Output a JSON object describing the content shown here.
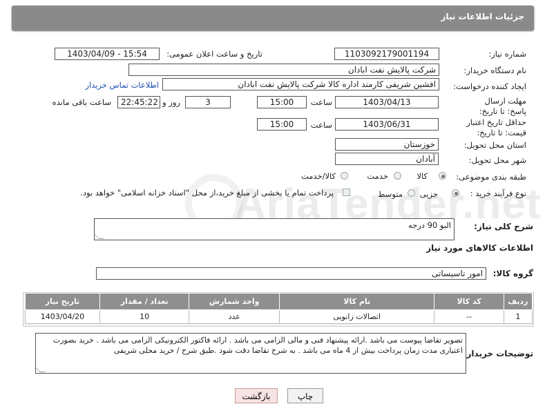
{
  "header": {
    "title": "جزئیات اطلاعات نیاز"
  },
  "watermark": {
    "text": "AriaTender.net"
  },
  "fields": {
    "need_number": {
      "label": "شماره نیاز:",
      "value": "1103092179001194"
    },
    "announce": {
      "label": "تاریخ و ساعت اعلان عمومی:",
      "value": "1403/04/09 - 15:54"
    },
    "buyer_org": {
      "label": "نام دستگاه خریدار:",
      "value": "شرکت پالایش نفت ابادان"
    },
    "requester": {
      "label": "ایجاد کننده درخواست:",
      "value": "افشین شریفی کارمند اداره کالا  شرکت پالایش نفت ابادان",
      "contact_link": "اطلاعات تماس خریدار"
    },
    "reply_deadline": {
      "label": "مهلت ارسال پاسخ: تا تاریخ:",
      "date": "1403/04/13",
      "time_label": "ساعت",
      "time": "15:00",
      "days": "3",
      "days_label": "روز و",
      "remaining": "22:45:22",
      "remaining_label": "ساعت باقی مانده"
    },
    "price_validity": {
      "label": "حداقل تاریخ اعتبار قیمت: تا تاریخ:",
      "date": "1403/06/31",
      "time_label": "ساعت",
      "time": "15:00"
    },
    "province": {
      "label": "استان محل تحویل:",
      "value": "خوزستان"
    },
    "city": {
      "label": "شهر محل تحویل:",
      "value": "آبادان"
    },
    "category": {
      "label": "طبقه بندی موضوعی:",
      "options": [
        "کالا",
        "خدمت",
        "کالا/خدمت"
      ],
      "selected": "کالا"
    },
    "process": {
      "label": "نوع فرآیند خرید :",
      "options": [
        "جزیی",
        "متوسط"
      ],
      "selected": "جزیی",
      "note": "پرداخت تمام یا بخشی از مبلغ خرید،از محل \"اسناد خزانه اسلامی\" خواهد بود."
    }
  },
  "summary": {
    "label": "شرح کلی نیاز:",
    "value": "البو 90 درجه"
  },
  "goods_section": {
    "title": "اطلاعات کالاهای مورد نیاز"
  },
  "goods_group": {
    "label": "گروه کالا:",
    "value": "امور تاسیساتی"
  },
  "table": {
    "headers": [
      "ردیف",
      "کد کالا",
      "نام کالا",
      "واحد شمارش",
      "تعداد / مقدار",
      "تاریخ نیاز"
    ],
    "rows": [
      [
        "1",
        "--",
        "اتصالات زانویی",
        "عدد",
        "10",
        "1403/04/20"
      ]
    ]
  },
  "buyer_notes": {
    "label": "توضیحات خریدار:",
    "value": "تصویر تقاضا پیوست می باشد .ارائه پیشنهاد فنی و مالی الزامی می باشد . ارائه فاکتور الکترونیکی الزامی می باشد . خرید بصورت اعتباری مدت زمان پرداخت بیش از 4 ماه می باشد . به شرح تقاضا دقت شود .طبق شرح / خرید محلی شریفی"
  },
  "buttons": {
    "print": "چاپ",
    "back": "بازگشت"
  }
}
